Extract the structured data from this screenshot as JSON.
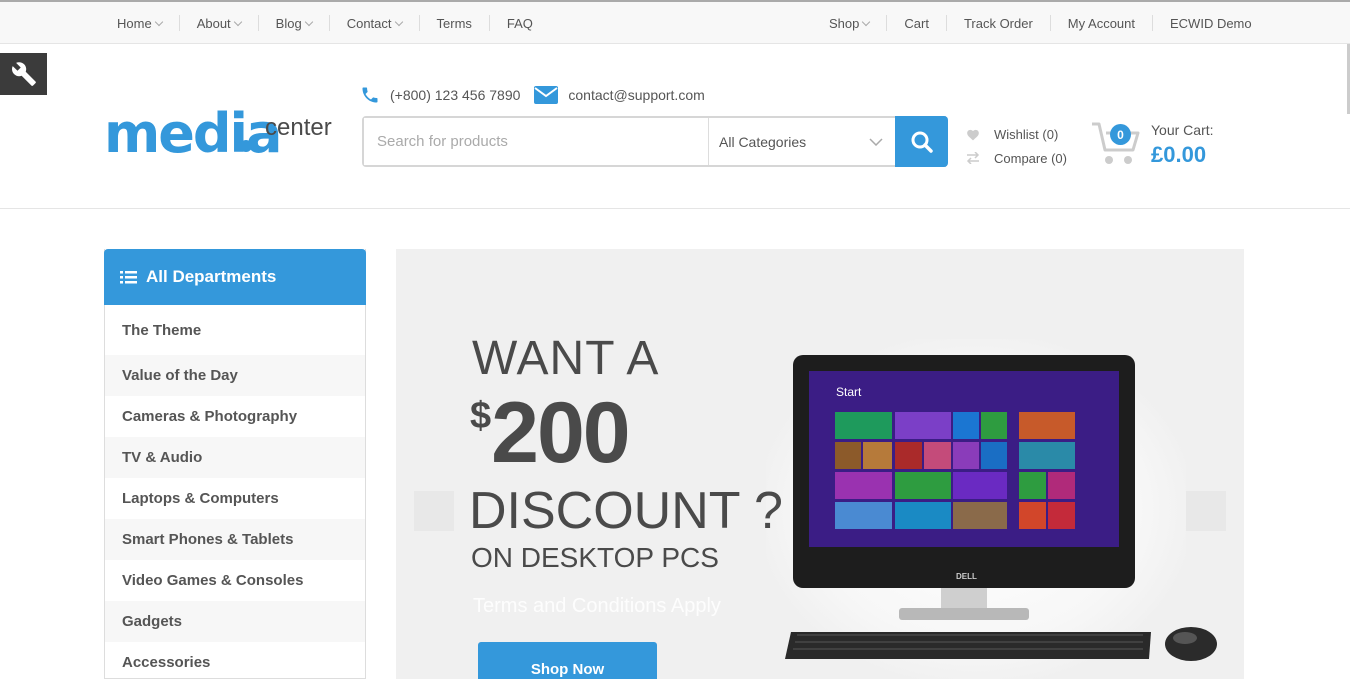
{
  "top_nav_left": [
    {
      "label": "Home",
      "dropdown": true
    },
    {
      "label": "About",
      "dropdown": true
    },
    {
      "label": "Blog",
      "dropdown": true
    },
    {
      "label": "Contact",
      "dropdown": true
    },
    {
      "label": "Terms",
      "dropdown": false
    },
    {
      "label": "FAQ",
      "dropdown": false
    }
  ],
  "top_nav_right": [
    {
      "label": "Shop",
      "dropdown": true
    },
    {
      "label": "Cart",
      "dropdown": false
    },
    {
      "label": "Track Order",
      "dropdown": false
    },
    {
      "label": "My Account",
      "dropdown": false
    },
    {
      "label": "ECWID Demo",
      "dropdown": false
    }
  ],
  "logo": {
    "main": "media",
    "sub": "center"
  },
  "contact": {
    "phone": "(+800) 123 456 7890",
    "email": "contact@support.com"
  },
  "search": {
    "placeholder": "Search for products",
    "category": "All Categories"
  },
  "wishlist": "Wishlist (0)",
  "compare": "Compare (0)",
  "cart": {
    "count": "0",
    "label": "Your Cart:",
    "amount": "£0.00"
  },
  "departments": {
    "title": "All Departments",
    "items": [
      "The Theme",
      "Value of the Day",
      "Cameras & Photography",
      "TV & Audio",
      "Laptops & Computers",
      "Smart Phones & Tablets",
      "Video Games & Consoles",
      "Gadgets",
      "Accessories"
    ]
  },
  "banner": {
    "line1": "WANT A",
    "currency": "$",
    "amount": "200",
    "line3": "DISCOUNT ?",
    "line4": "ON DESKTOP PCS",
    "terms": "Terms and Conditions Apply",
    "button": "Shop Now",
    "screen_start": "Start",
    "monitor_brand": "DELL"
  },
  "colors": {
    "accent": "#3498db",
    "dark": "#4a4a4a",
    "toolbar": "#3b3b3b"
  }
}
